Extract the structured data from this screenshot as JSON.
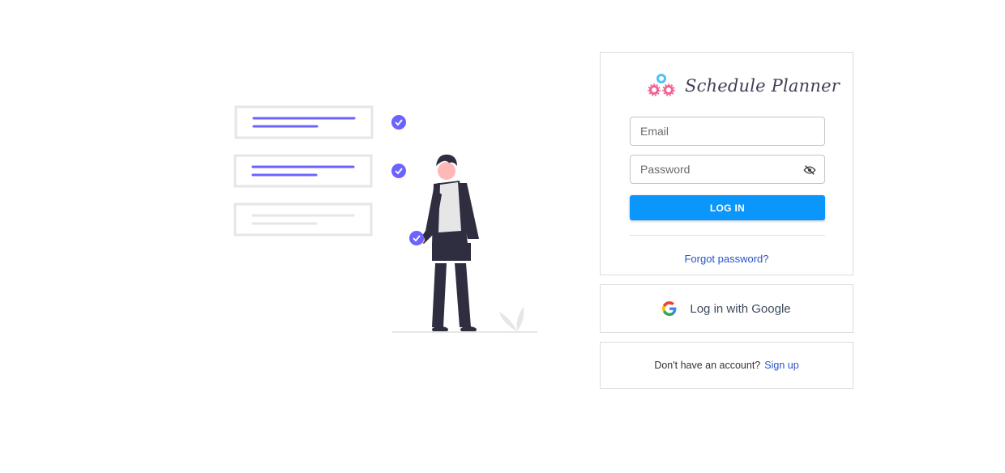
{
  "app": {
    "name": "Schedule Planner"
  },
  "login_form": {
    "email_placeholder": "Email",
    "email_value": "",
    "password_placeholder": "Password",
    "password_value": "",
    "login_label": "LOG IN",
    "forgot_password_label": "Forgot password?"
  },
  "google_login": {
    "label": "Log in with Google"
  },
  "signup": {
    "prompt": "Don't have an account?",
    "link_label": "Sign up"
  },
  "illustration": {
    "tasks": [
      {
        "checked": true
      },
      {
        "checked": true
      },
      {
        "checked": false
      }
    ]
  },
  "icons": {
    "eye_toggle": "eye-slash-icon",
    "logo": "schedule-planner-logo",
    "google": "google-g-icon",
    "check": "check-circle-icon"
  },
  "colors": {
    "primary_button": "#0a96fa",
    "link": "#2a54c8",
    "accent_purple": "#6c63ff",
    "logo_blue": "#4fc3f7",
    "logo_pink": "#f06292"
  }
}
